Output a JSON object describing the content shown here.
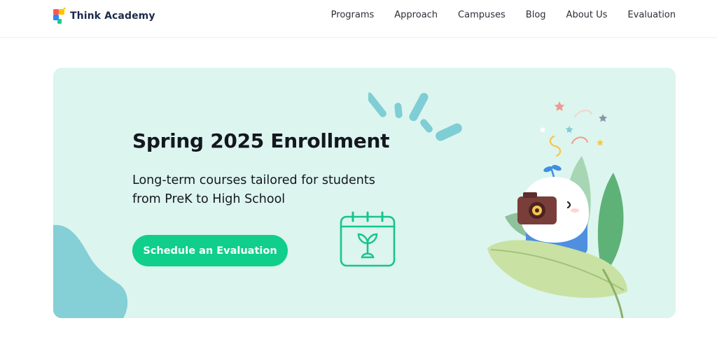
{
  "brand": {
    "name": "Think Academy"
  },
  "nav": {
    "items": [
      "Programs",
      "Approach",
      "Campuses",
      "Blog",
      "About Us",
      "Evaluation"
    ]
  },
  "hero": {
    "title": "Spring 2025 Enrollment",
    "subtitle_line1": "Long-term courses tailored for students",
    "subtitle_line2": "from PreK to High School",
    "cta_label": "Schedule an Evaluation"
  },
  "icons": {
    "logo": "think-academy-logo-icon",
    "calendar": "calendar-sprout-icon",
    "mascot": "mascot-with-camera-illustration"
  },
  "colors": {
    "banner_bg": "#dcf5ee",
    "cta_bg": "#0fcf8b",
    "accent_blue": "#85cfd6",
    "icon_green": "#19c48a",
    "brand_navy": "#1b2a4a"
  }
}
